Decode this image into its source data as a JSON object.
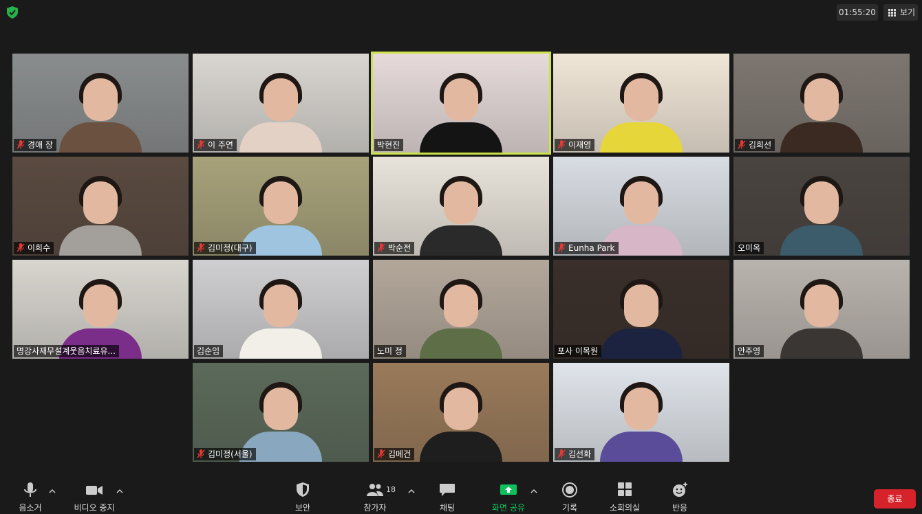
{
  "app": {
    "timer": "01:55:20",
    "view_label": "보기",
    "shield_icon": "shield-check-icon"
  },
  "participants": [
    {
      "name": "경애 장",
      "muted": true,
      "bg": "#8a8d8e",
      "shirt": "#6b5140"
    },
    {
      "name": "이 주연",
      "muted": true,
      "bg": "#d9d6d1",
      "shirt": "#e3d1c6"
    },
    {
      "name": "박현진",
      "muted": false,
      "active": true,
      "bg": "#e6dada",
      "shirt": "#141414"
    },
    {
      "name": "이재영",
      "muted": true,
      "bg": "#f0e6d7",
      "shirt": "#e7d63a"
    },
    {
      "name": "김희선",
      "muted": true,
      "bg": "#7d7670",
      "shirt": "#3b2a22"
    },
    {
      "name": "이희수",
      "muted": true,
      "bg": "#5a4a40",
      "shirt": "#a39f9a"
    },
    {
      "name": "김미정(대구)",
      "muted": true,
      "bg": "#a7a27a",
      "shirt": "#9fc4e0"
    },
    {
      "name": "박순전",
      "muted": true,
      "bg": "#e8e3da",
      "shirt": "#2a2a2a"
    },
    {
      "name": "Eunha Park",
      "muted": true,
      "bg": "#d8dde3",
      "shirt": "#d7b6c7"
    },
    {
      "name": "오미옥",
      "muted": false,
      "bg": "#4a4440",
      "shirt": "#3c5b6b"
    },
    {
      "name": "명강사재무설계웃음치료유...",
      "muted": false,
      "bg": "#d8d5cf",
      "shirt": "#7b2d8a"
    },
    {
      "name": "김순임",
      "muted": false,
      "bg": "#cfcfd1",
      "shirt": "#f2efe8"
    },
    {
      "name": "노미 정",
      "muted": false,
      "bg": "#b3a79a",
      "shirt": "#5e6e46"
    },
    {
      "name": "포사 이목원",
      "muted": false,
      "bg": "#3a2f2a",
      "shirt": "#1c2340"
    },
    {
      "name": "안주영",
      "muted": false,
      "bg": "#b9b3ad",
      "shirt": "#3a3634"
    },
    {
      "name": "김미정(서울)",
      "muted": true,
      "bg": "#5b6a5a",
      "shirt": "#8aa7c0"
    },
    {
      "name": "김메건",
      "muted": true,
      "bg": "#9a7a5a",
      "shirt": "#1e1e1e"
    },
    {
      "name": "김선화",
      "muted": true,
      "bg": "#dfe4ea",
      "shirt": "#5b4c9a"
    }
  ],
  "toolbar": {
    "mute_label": "음소거",
    "video_label": "비디오 중지",
    "security_label": "보안",
    "participants_label": "참가자",
    "participants_count": "18",
    "chat_label": "채팅",
    "share_label": "화면 공유",
    "record_label": "기록",
    "breakout_label": "소회의실",
    "reactions_label": "반응",
    "end_label": "종료"
  },
  "colors": {
    "background": "#1a1a1a",
    "active_speaker": "#cde24a",
    "share_green": "#0ec15b",
    "end_red": "#d6232b",
    "mute_red": "#e53935"
  }
}
